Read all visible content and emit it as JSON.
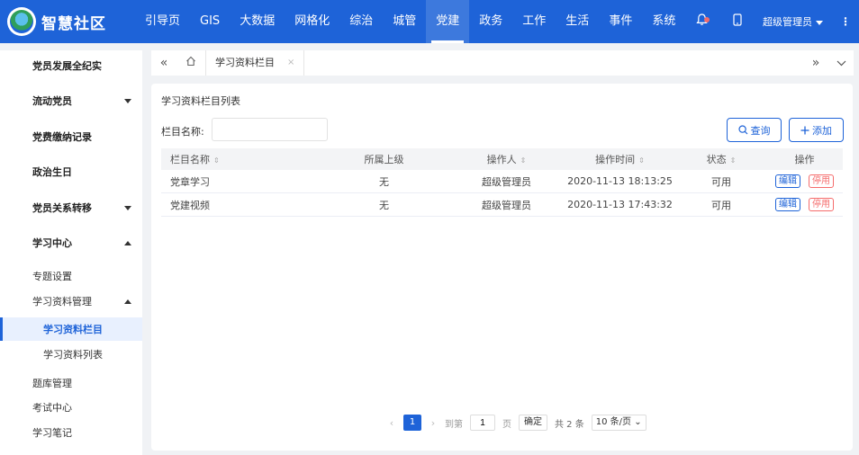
{
  "app": {
    "title": "智慧社区",
    "nav": [
      "引导页",
      "GIS",
      "大数据",
      "网格化",
      "综治",
      "城管",
      "党建",
      "政务",
      "工作",
      "生活",
      "事件",
      "系统"
    ],
    "active_nav": "党建",
    "user": "超级管理员"
  },
  "sidebar": {
    "items": [
      {
        "label": "党员发展全纪实",
        "level": 1
      },
      {
        "label": "流动党员",
        "level": 1,
        "arrow": "down"
      },
      {
        "label": "党费缴纳记录",
        "level": 1
      },
      {
        "label": "政治生日",
        "level": 1
      },
      {
        "label": "党员关系转移",
        "level": 1,
        "arrow": "down"
      },
      {
        "label": "学习中心",
        "level": 1,
        "arrow": "up"
      },
      {
        "label": "专题设置",
        "level": 2
      },
      {
        "label": "学习资料管理",
        "level": 2,
        "arrow": "up"
      },
      {
        "label": "学习资料栏目",
        "level": 3,
        "active": true
      },
      {
        "label": "学习资料列表",
        "level": 3
      },
      {
        "label": "题库管理",
        "level": 2
      },
      {
        "label": "考试中心",
        "level": 2
      },
      {
        "label": "学习笔记",
        "level": 2
      }
    ]
  },
  "tabs": {
    "active": "学习资料栏目",
    "close": "×"
  },
  "main": {
    "title": "学习资料栏目列表",
    "filter_label": "栏目名称:",
    "filter_value": "",
    "query_button": "查询",
    "add_button": "添加",
    "columns": [
      "栏目名称",
      "所属上级",
      "操作人",
      "操作时间",
      "状态",
      "操作"
    ],
    "rows": [
      {
        "name": "党章学习",
        "parent": "无",
        "operator": "超级管理员",
        "time": "2020-11-13 18:13:25",
        "status": "可用",
        "edit": "编辑",
        "disable": "停用"
      },
      {
        "name": "党建视频",
        "parent": "无",
        "operator": "超级管理员",
        "time": "2020-11-13 17:43:32",
        "status": "可用",
        "edit": "编辑",
        "disable": "停用"
      }
    ]
  },
  "pagination": {
    "current_page": "1",
    "goto_label": "到第",
    "goto_value": "1",
    "page_unit": "页",
    "confirm": "确定",
    "total": "共 2 条",
    "page_size": "10 条/页"
  },
  "colors": {
    "primary": "#1e63d8",
    "danger": "#f56c6c"
  }
}
